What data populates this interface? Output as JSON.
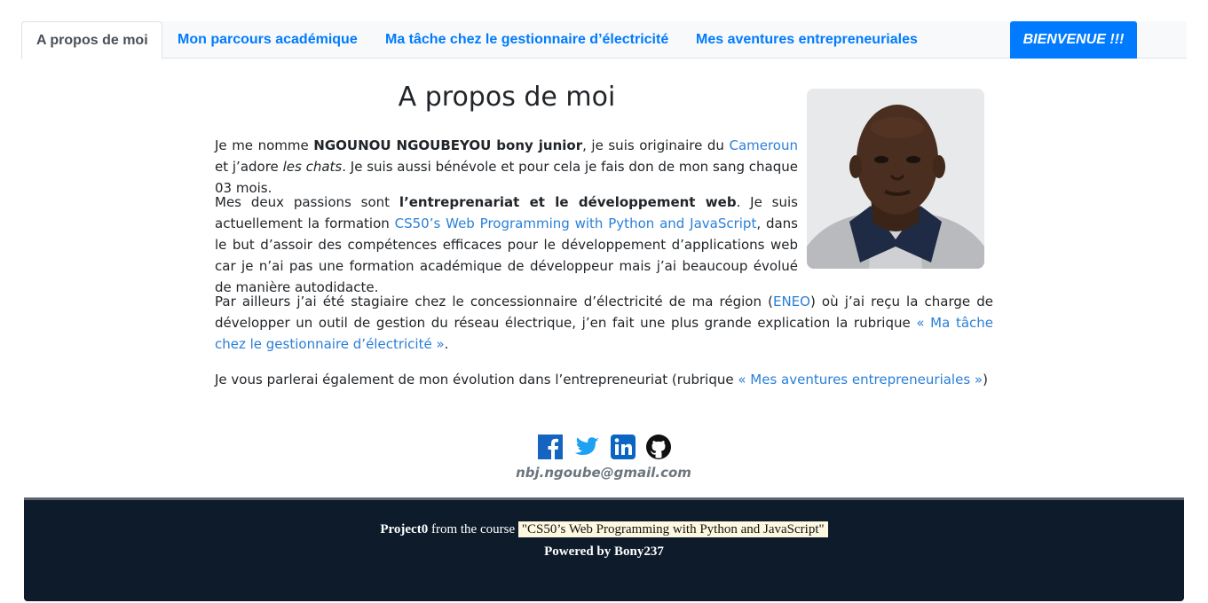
{
  "nav": {
    "tabs": [
      {
        "label": "A propos de moi",
        "active": true
      },
      {
        "label": "Mon parcours académique"
      },
      {
        "label": "Ma tâche chez le gestionnaire d’électricité"
      },
      {
        "label": "Mes aventures entrepreneuriales"
      }
    ],
    "welcome_label": "BIENVENUE !!!"
  },
  "main": {
    "title": "A propos de moi",
    "photo_alt": "portrait",
    "p1": {
      "t1": "Je me nomme ",
      "name": "NGOUNOU NGOUBEYOU bony junior",
      "t2": ", je suis originaire du ",
      "link_cameroun": "Cameroun",
      "t3": " et j’adore ",
      "cats": "les chats",
      "t4": ". Je suis aussi bénévole et pour cela je fais don de mon sang chaque 03 mois."
    },
    "p2": {
      "t1": "Mes deux passions sont ",
      "passions": "l’entreprenariat et le développement web",
      "t2": ". Je suis actuellement la formation ",
      "link_cs50": "CS50’s Web Programming with Python and JavaScript",
      "t3": ", dans le but d’assoir des compétences efficaces pour le développement d’applications web car je n’ai pas une formation académique de développeur mais j’ai beaucoup évolué de manière autodidacte."
    },
    "p3": {
      "t1": "Par ailleurs j’ai été stagiaire chez le concessionnaire d’électricité de ma région (",
      "link_eneo": "ENEO",
      "t2": ") où j’ai reçu la charge de développer un outil de gestion du réseau électrique, j’en fait une plus grande explication la rubrique ",
      "link_tache": "« Ma tâche chez le gestionnaire d’électricité »",
      "t3": "."
    },
    "p4": {
      "t1": "Je vous parlerai également de mon évolution dans l’entrepreneuriat (rubrique ",
      "link_aventures": "« Mes aventures entrepreneuriales »",
      "t2": ")"
    }
  },
  "social": {
    "icons": [
      "facebook-icon",
      "twitter-icon",
      "linkedin-icon",
      "github-icon"
    ],
    "colors": {
      "facebook": "#1565c0",
      "twitter": "#1da1f2",
      "linkedin": "#0a66c2",
      "github": "#111111"
    },
    "email": "nbj.ngoube@gmail.com"
  },
  "footer": {
    "project": "Project0",
    "from_course": " from the course ",
    "course": "\"CS50’s Web Programming with Python and JavaScript\"",
    "powered": "Powered by Bony237"
  },
  "colors": {
    "accent": "#007bff",
    "link": "#2a7fd8",
    "footer_bg": "#0d1b2a"
  }
}
